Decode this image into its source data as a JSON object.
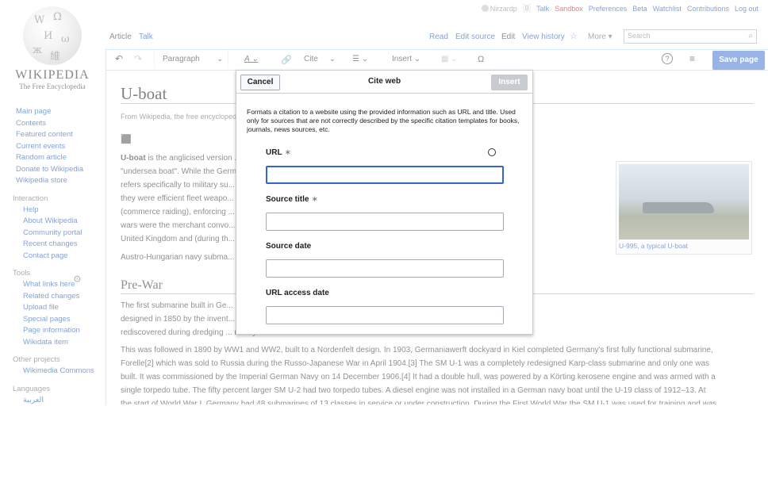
{
  "logo": {
    "wordmark": "WIKIPEDIA",
    "tagline": "The Free Encyclopedia"
  },
  "personal": {
    "username": "Nirzardp",
    "notif_count": "0",
    "links": [
      "Talk",
      "Sandbox",
      "Preferences",
      "Beta",
      "Watchlist",
      "Contributions",
      "Log out"
    ]
  },
  "tabs": {
    "article": "Article",
    "talk": "Talk",
    "read": "Read",
    "edit_source": "Edit source",
    "edit": "Edit",
    "history": "View history",
    "more": "More"
  },
  "search": {
    "placeholder": "Search"
  },
  "toolbar": {
    "paragraph": "Paragraph",
    "cite": "Cite",
    "insert": "Insert",
    "omega": "Ω",
    "save": "Save page"
  },
  "sidebar": {
    "main": [
      "Main page",
      "Contents",
      "Featured content",
      "Current events",
      "Random article",
      "Donate to Wikipedia",
      "Wikipedia store"
    ],
    "interaction_heading": "Interaction",
    "interaction": [
      "Help",
      "About Wikipedia",
      "Community portal",
      "Recent changes",
      "Contact page"
    ],
    "tools_heading": "Tools",
    "tools": [
      "What links here",
      "Related changes",
      "Upload file",
      "Special pages",
      "Page information",
      "Wikidata item"
    ],
    "other_heading": "Other projects",
    "other": [
      "Wikimedia Commons"
    ],
    "languages_heading": "Languages",
    "languages": [
      "العربية"
    ]
  },
  "article": {
    "title": "U-boat",
    "tagline": "From Wikipedia, the free encyclopedia",
    "p1_a": "U-boat",
    "p1_b": " is the anglicised version ... erally",
    "p1_lines": [
      "\"undersea boat\". While the German ... er languages)",
      "refers specifically to military su...  Although at times",
      "they were efficient fleet weapo...  c warfare role",
      "(commerce raiding), enforcing ...  paigns in both",
      "wars were the merchant convo...  e islands of the",
      "United Kingdom and (during th...  ranean."
    ],
    "p1_tail": "Austro-Hungarian navy subma...",
    "section": "Pre-War",
    "p2_lines": [
      "The first submarine built in Ge...  Kiel harbor during its first test dive.[1] The vessel was",
      "designed in 1850 by the invent...  Imperial German Navy. Brandtaucher was later",
      "rediscovered during dredging ...  rmany."
    ],
    "p3_lines": [
      "This was followed in 1890 by WW1 and WW2, built to a Nordenfelt design. In 1903, Germaniawerft dockyard in Kiel completed Germany's first fully functional submarine,",
      "Forelle[2] which was sold to Russia during the Russo-Japanese War in April 1904.[3] The SM U-1 was a completely redesigned Karp-class submarine and only one was",
      "built. It was commissioned by the Imperial German Navy on 14 December 1906.[4] It had a double hull, was powered by a Körting kerosene engine and was armed with a",
      "single torpedo tube. The fifty percent larger SM U-2 had two torpedo tubes. A diesel engine was not installed in a German navy boat until the U-19 class of 1912–13. At",
      "the start of World War I, Germany had 48 submarines of 13 classes in service or under construction. During the First World War the SM U-1 was used for training and was"
    ],
    "infobox_caption": "U-995, a typical U-boat"
  },
  "dialog": {
    "cancel": "Cancel",
    "title": "Cite web",
    "insert": "Insert",
    "description": "Formats a citation to a website using the provided information such as URL and title. Used only for sources that are not correctly described by the specific citation templates for books, journals, news sources, etc.",
    "fields": [
      {
        "label": "URL",
        "required": "∗"
      },
      {
        "label": "Source title",
        "required": "∗"
      },
      {
        "label": "Source date",
        "required": ""
      },
      {
        "label": "URL access date",
        "required": ""
      }
    ]
  }
}
